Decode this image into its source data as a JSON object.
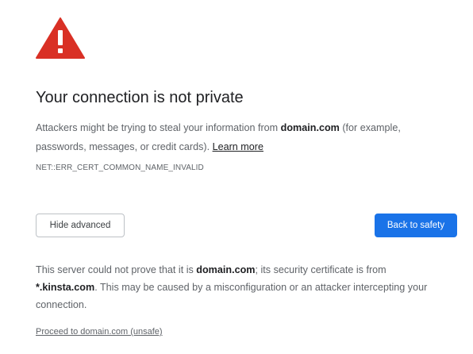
{
  "warning_icon": {
    "name": "warning-triangle-icon",
    "color": "#d93025"
  },
  "title": "Your connection is not private",
  "intro": {
    "text_before": "Attackers might be trying to steal your information from ",
    "domain": "domain.com",
    "text_after": " (for example, passwords, messages, or credit cards). ",
    "learn_more": "Learn more"
  },
  "error_code": "NET::ERR_CERT_COMMON_NAME_INVALID",
  "buttons": {
    "hide_advanced": "Hide advanced",
    "back_to_safety": "Back to safety"
  },
  "details": {
    "text_1": "This server could not prove that it is ",
    "domain": "domain.com",
    "text_2": "; its security certificate is from ",
    "cert_domain": "*.kinsta.com",
    "text_3": ". This may be caused by a misconfiguration or an attacker intercepting your connection."
  },
  "proceed_link": "Proceed to domain.com (unsafe)",
  "colors": {
    "accent": "#1a73e8",
    "danger": "#d93025"
  }
}
